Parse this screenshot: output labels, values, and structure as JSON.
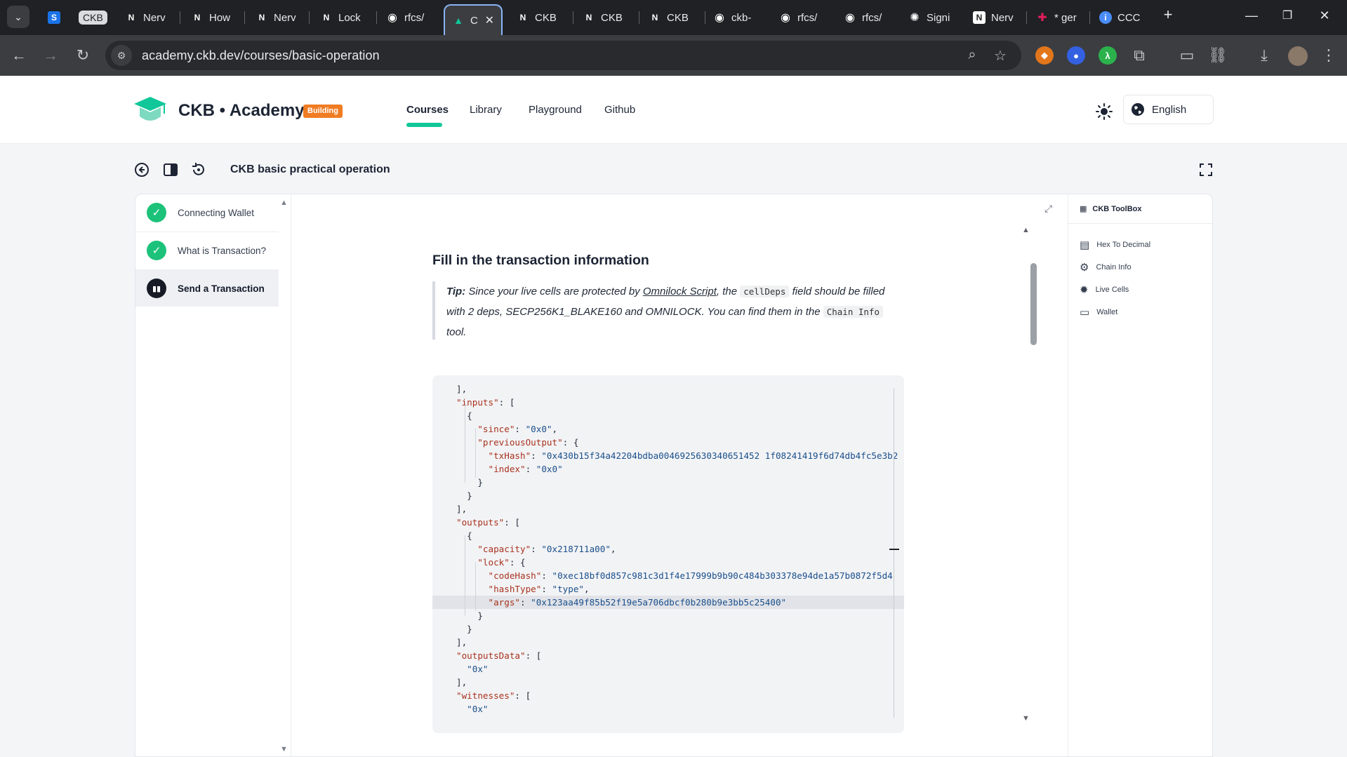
{
  "browser": {
    "tabs": [
      {
        "label": "",
        "icon": "s-app-icon",
        "color": "#1a73e8"
      },
      {
        "label": "CKB",
        "icon": "ckb-tab-chip"
      },
      {
        "label": "Nerv",
        "icon": "nervos-icon"
      },
      {
        "label": "How",
        "icon": "nervos-icon"
      },
      {
        "label": "Nerv",
        "icon": "nervos-icon"
      },
      {
        "label": "Lock",
        "icon": "nervos-icon"
      },
      {
        "label": "rfcs/",
        "icon": "github-icon"
      },
      {
        "label": "C",
        "icon": "academy-icon",
        "active": true
      },
      {
        "label": "CKB",
        "icon": "nervos-icon"
      },
      {
        "label": "CKB",
        "icon": "nervos-icon"
      },
      {
        "label": "CKB",
        "icon": "nervos-icon"
      },
      {
        "label": "ckb-",
        "icon": "github-icon"
      },
      {
        "label": "rfcs/",
        "icon": "github-icon"
      },
      {
        "label": "rfcs/",
        "icon": "github-icon"
      },
      {
        "label": "Signi",
        "icon": "openai-icon"
      },
      {
        "label": "Nerv",
        "icon": "nervos-icon"
      },
      {
        "label": "* ger",
        "icon": "slack-icon"
      },
      {
        "label": "CCC",
        "icon": "info-icon"
      }
    ],
    "url": "academy.ckb.dev/courses/basic-operation"
  },
  "site": {
    "brand": "CKB • Academy",
    "badge": "Building",
    "nav": [
      "Courses",
      "Library",
      "Playground",
      "Github"
    ],
    "active_nav": "Courses",
    "language": "English",
    "accent": "#10c79a"
  },
  "course": {
    "title": "CKB basic practical operation",
    "steps": [
      {
        "label": "Connecting Wallet",
        "status": "done"
      },
      {
        "label": "What is Transaction?",
        "status": "done"
      },
      {
        "label": "Send a Transaction",
        "status": "current"
      }
    ]
  },
  "lesson": {
    "heading": "Fill in the transaction information",
    "tip_label": "Tip:",
    "tip_1": " Since your live cells are protected by ",
    "tip_link": "Omnilock Script",
    "tip_2": ", the ",
    "tip_code_1": "cellDeps",
    "tip_3": " field should be filled with 2 deps, SECP256K1_BLAKE160 and OMNILOCK. You can find them in the ",
    "tip_code_2": "Chain Info",
    "tip_4": " tool."
  },
  "code_lines": [
    "],",
    "\"inputs\": [",
    "  {",
    "    \"since\": \"0x0\",",
    "    \"previousOutput\": {",
    "      \"txHash\": \"0x430b15f34a42204bdba0046925630340651452 1f08241419f6d74db4fc5e3b2",
    "      \"index\": \"0x0\"",
    "    }",
    "  }",
    "],",
    "\"outputs\": [",
    "  {",
    "    \"capacity\": \"0x218711a00\",",
    "    \"lock\": {",
    "      \"codeHash\": \"0xec18bf0d857c981c3d1f4e17999b9b90c484b303378e94de1a57b0872f5d4",
    "      \"hashType\": \"type\",",
    "      \"args\": \"0x123aa49f85b52f19e5a706dbcf0b280b9e3bb5c25400\"",
    "    }",
    "  }",
    "],",
    "\"outputsData\": [",
    "  \"0x\"",
    "],",
    "\"witnesses\": [",
    "  \"0x\""
  ],
  "toolbox": {
    "title": "CKB ToolBox",
    "items": [
      "Hex To Decimal",
      "Chain Info",
      "Live Cells",
      "Wallet"
    ]
  }
}
